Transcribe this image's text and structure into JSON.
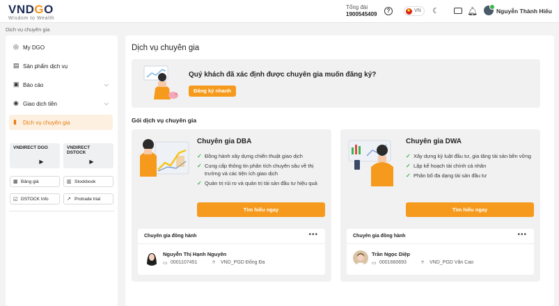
{
  "brand": {
    "logo_text": "VNDGO",
    "tagline": "Wisdom to Wealth",
    "accent": "#f59a1c"
  },
  "header": {
    "hotline_label": "Tổng đài",
    "hotline_number": "1900545409",
    "language": "VN",
    "user_name": "Nguyễn Thành Hiếu"
  },
  "breadcrumb": "Dịch vụ chuyên gia",
  "sidebar": {
    "items": [
      {
        "label": "My DGO",
        "icon": "dgo-icon"
      },
      {
        "label": "Sản phẩm dịch vụ",
        "icon": "document-icon"
      },
      {
        "label": "Báo cáo",
        "icon": "report-icon"
      },
      {
        "label": "Giao dịch tiền",
        "icon": "money-icon"
      },
      {
        "label": "Dịch vụ chuyên gia",
        "icon": "expert-icon"
      }
    ],
    "apps": [
      {
        "title": "VNDIRECT DGO"
      },
      {
        "title": "VNDIRECT DSTOCK"
      }
    ],
    "tools": [
      {
        "label": "Bảng giá"
      },
      {
        "label": "Stockbook"
      },
      {
        "label": "DSTOCK Info"
      },
      {
        "label": "Protrade trial"
      }
    ]
  },
  "main": {
    "title": "Dịch vụ chuyên gia",
    "banner_question": "Quý khách đã xác định được chuyên gia muốn đăng ký?",
    "banner_button": "Đăng ký nhanh",
    "section_title": "Gói dịch vụ chuyên gia",
    "cards": [
      {
        "title": "Chuyên gia DBA",
        "bullets": [
          "Đồng hành xây dựng chiến thuật giao dịch",
          "Cung cấp thông tin phân tích chuyên sâu về thị trường và các tiện ích giao dịch",
          "Quản trị rủi ro và quản trị tài sản đầu tư hiệu quả"
        ],
        "button": "Tìm hiểu ngay",
        "partner_heading": "Chuyên gia đồng hành",
        "partner_name": "Nguyễn Thị Hạnh Nguyên",
        "partner_id": "0001107451",
        "partner_location": "VND_PGD Đống Đa"
      },
      {
        "title": "Chuyên gia DWA",
        "bullets": [
          "Xây dựng kỷ luật đầu tư, gia tăng tài sản bền vững",
          "Lập kế hoạch tài chính cá nhân",
          "Phân bổ đa dạng tài sản đầu tư"
        ],
        "button": "Tìm hiểu ngay",
        "partner_heading": "Chuyên gia đồng hành",
        "partner_name": "Trần Ngọc Diệp",
        "partner_id": "0001660693",
        "partner_location": "VND_PGD Văn Cao"
      }
    ]
  }
}
